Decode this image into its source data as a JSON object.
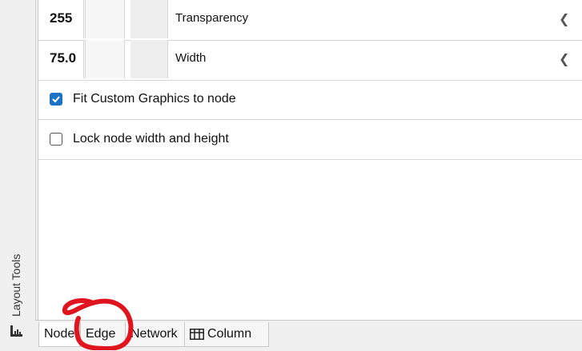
{
  "properties": [
    {
      "value": "255",
      "label": "Transparency"
    },
    {
      "value": "75.0",
      "label": "Width"
    }
  ],
  "checkboxes": [
    {
      "label": "Fit Custom Graphics to node",
      "checked": true
    },
    {
      "label": "Lock node width and height",
      "checked": false
    }
  ],
  "side_panel": {
    "label": "Layout Tools"
  },
  "tabs": {
    "node": "Node",
    "edge": "Edge",
    "network": "Network",
    "column": "Column"
  },
  "colors": {
    "checkbox_accent": "#1a73c7",
    "annotation": "#e0141e"
  }
}
